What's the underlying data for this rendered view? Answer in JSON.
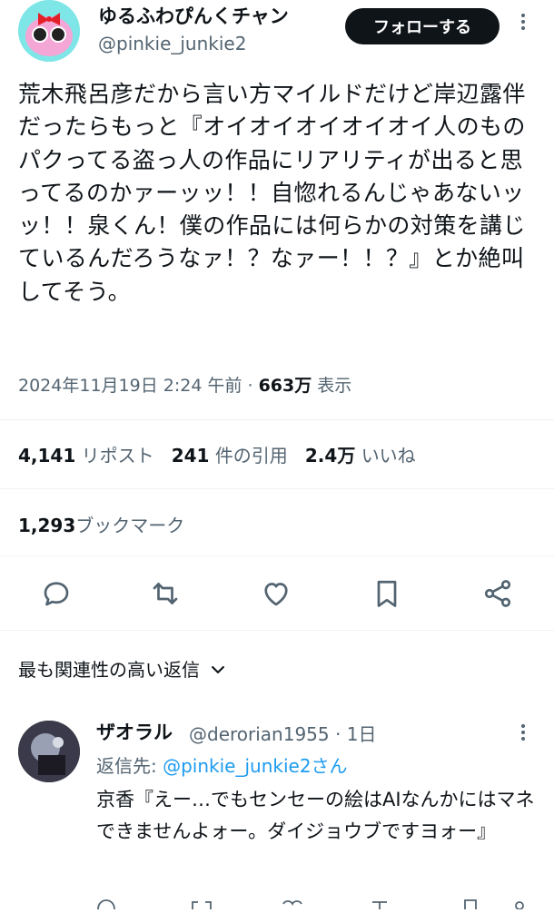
{
  "tweet": {
    "author": {
      "display_name": "ゆるふわぴんくチャン",
      "handle": "@pinkie_junkie2",
      "follow_label": "フォローする"
    },
    "text": "荒木飛呂彦だから言い方マイルドだけど岸辺露伴だったらもっと『オイオイオイオイオイ人のものパクってる盗っ人の作品にリアリティが出ると思ってるのかァーッッ！！自惚れるんじゃあないッッ！！泉くん！僕の作品には何らかの対策を講じているんだろうなァ！？なァー！！？』とか絶叫してそう。",
    "timestamp": "2024年11月19日 2:24 午前",
    "separator": " · ",
    "views_count": "663万",
    "views_label": "表示",
    "stats": {
      "reposts_count": "4,141",
      "reposts_label": "リポスト",
      "quotes_count": "241",
      "quotes_label": "件の引用",
      "likes_count": "2.4万",
      "likes_label": "いいね"
    },
    "bookmarks_count": "1,293",
    "bookmarks_label": "ブックマーク"
  },
  "icons": {
    "actions": [
      "reply-icon",
      "repost-icon",
      "like-icon",
      "bookmark-icon",
      "share-icon"
    ],
    "more": "more-icon",
    "sort": "chevron-down-icon"
  },
  "replies_sort_label": "最も関連性の高い返信",
  "reply": {
    "display_name": "ザオラル",
    "handle": "@derorian1955",
    "separator": " · ",
    "time": "1日",
    "reply_to_prefix": "返信先: ",
    "reply_to_handle": "@pinkie_junkie2さん",
    "text": "京香『えー…でもセンセーの絵はAIなんかにはマネできませんよォー。ダイジョウブですヨォー』"
  },
  "colors": {
    "text": "#0f1419",
    "muted": "#536471",
    "link": "#1d9bf0",
    "divider": "#eff3f4",
    "button": "#0f1419"
  }
}
